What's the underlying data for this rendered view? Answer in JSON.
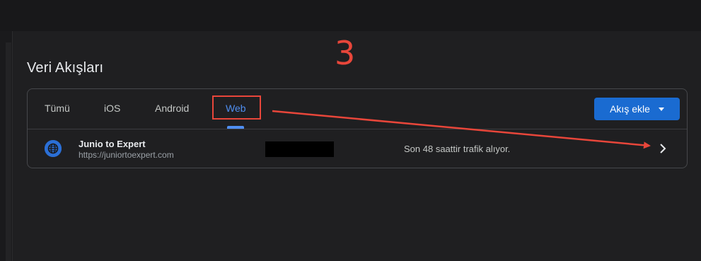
{
  "page": {
    "title": "Veri Akışları",
    "annotation_number": "3"
  },
  "tabs": [
    {
      "label": "Tümü",
      "active": false
    },
    {
      "label": "iOS",
      "active": false
    },
    {
      "label": "Android",
      "active": false
    },
    {
      "label": "Web",
      "active": true
    }
  ],
  "add_stream_button": {
    "label": "Akış ekle"
  },
  "streams": [
    {
      "name": "Junio to Expert",
      "url": "https://juniortoexpert.com",
      "status": "Son 48 saattir trafik alıyor."
    }
  ],
  "colors": {
    "accent": "#4f8ef0",
    "button": "#1a6bd1",
    "annotation": "#e8463a",
    "background": "#1f1f21"
  },
  "icons": {
    "stream_icon": "globe-icon",
    "row_action": "chevron-right-icon",
    "dropdown": "caret-down-icon"
  }
}
